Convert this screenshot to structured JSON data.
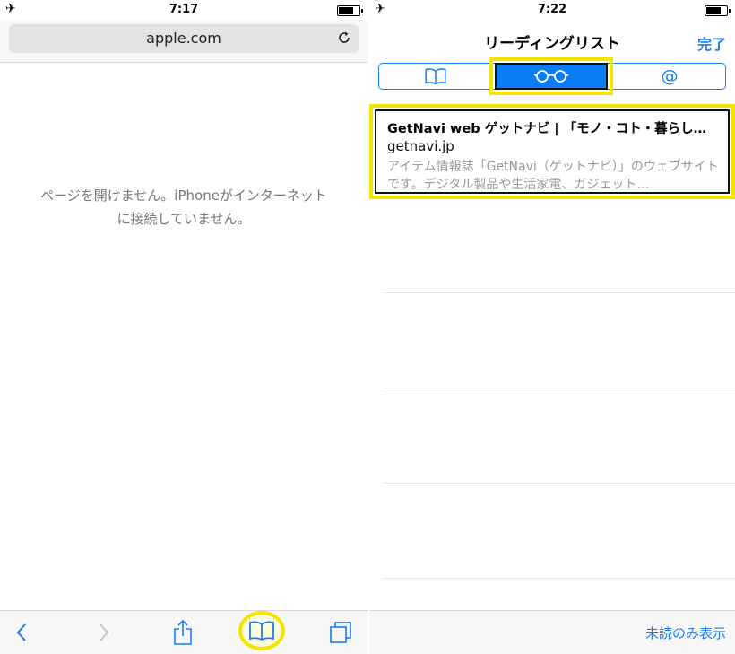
{
  "left_screen": {
    "status_bar": {
      "time": "7:17",
      "icons": [
        "airplane-icon",
        "battery-icon"
      ]
    },
    "address_bar": {
      "url": "apple.com",
      "reload_icon": "reload-icon"
    },
    "error_message": "ページを開けません。iPhoneがインターネットに接続していません。",
    "toolbar": {
      "icons": [
        "back-icon",
        "forward-icon",
        "share-icon",
        "bookmarks-icon",
        "tabs-icon"
      ],
      "highlighted": "bookmarks-icon"
    }
  },
  "right_screen": {
    "status_bar": {
      "time": "7:22",
      "icons": [
        "airplane-icon",
        "battery-icon"
      ]
    },
    "nav": {
      "title": "リーディングリスト",
      "done_label": "完了"
    },
    "segments": [
      {
        "icon": "bookmarks-icon",
        "selected": false
      },
      {
        "icon": "reading-list-glasses-icon",
        "selected": true
      },
      {
        "icon": "shared-links-at-icon",
        "selected": false
      }
    ],
    "reading_list": [
      {
        "title": "GetNavi web ゲットナビ | 「モノ・コト・暮らし…",
        "domain": "getnavi.jp",
        "description": "アイテム情報誌「GetNavi（ゲットナビ）」のウェブサイトです。デジタル製品や生活家電、ガジェット…"
      }
    ],
    "toolbar": {
      "unread_only_label": "未読のみ表示"
    }
  },
  "colors": {
    "accent": "#1b7cf0",
    "highlight": "#f2e600",
    "segment_selected": "#0a7df5"
  }
}
